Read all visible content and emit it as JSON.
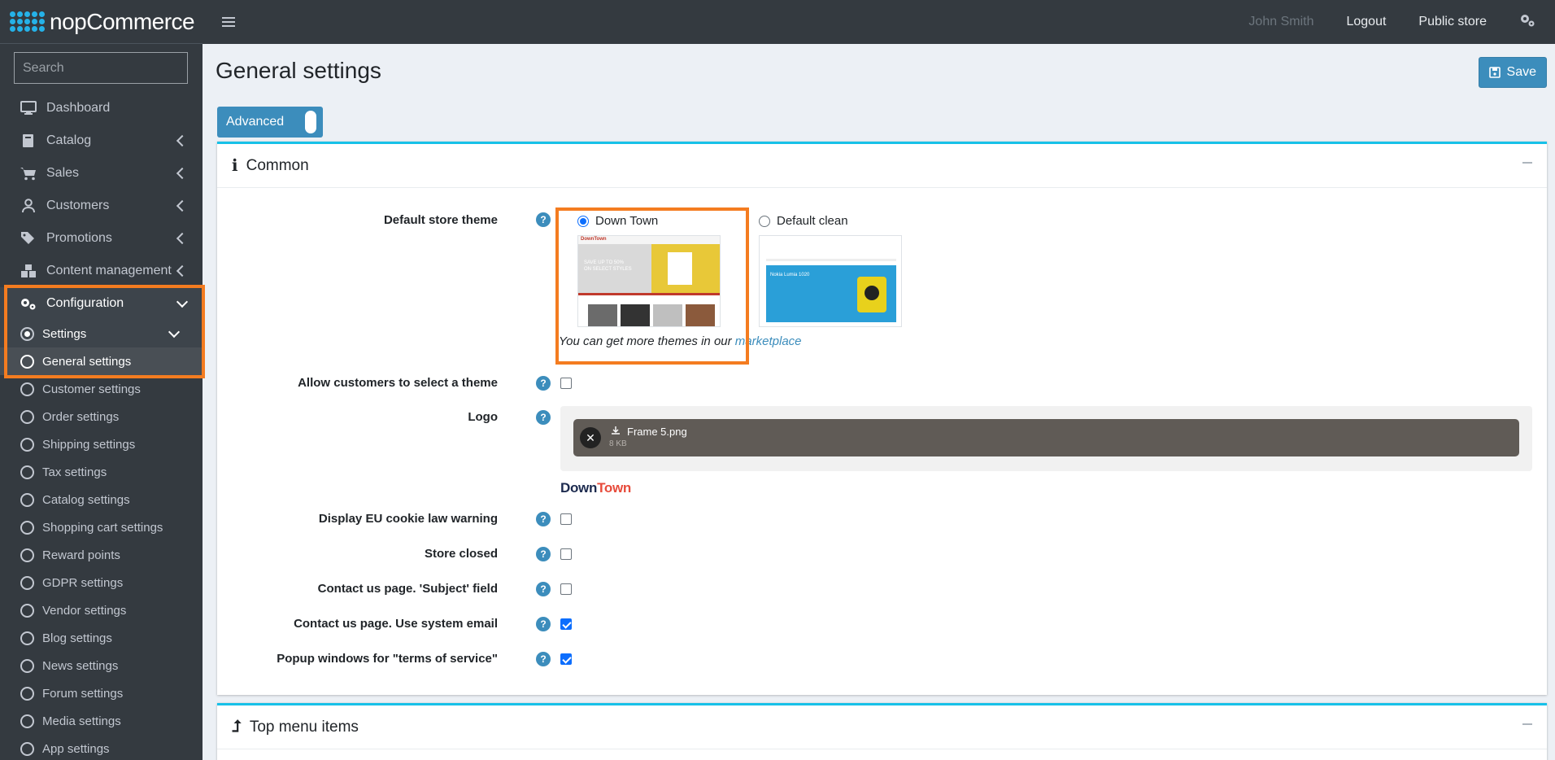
{
  "brand": {
    "name": "nopCommerce"
  },
  "search": {
    "placeholder": "Search"
  },
  "topbar": {
    "user": "John Smith",
    "logout": "Logout",
    "public_store": "Public store"
  },
  "sidebar": {
    "items": [
      {
        "label": "Dashboard"
      },
      {
        "label": "Catalog"
      },
      {
        "label": "Sales"
      },
      {
        "label": "Customers"
      },
      {
        "label": "Promotions"
      },
      {
        "label": "Content management"
      },
      {
        "label": "Configuration"
      }
    ],
    "sub_items": [
      "Settings",
      "General settings",
      "Customer settings",
      "Order settings",
      "Shipping settings",
      "Tax settings",
      "Catalog settings",
      "Shopping cart settings",
      "Reward points",
      "GDPR settings",
      "Vendor settings",
      "Blog settings",
      "News settings",
      "Forum settings",
      "Media settings",
      "App settings"
    ]
  },
  "page": {
    "title": "General settings",
    "save_label": "Save",
    "advanced_label": "Advanced"
  },
  "common": {
    "header": "Common",
    "default_theme_label": "Default store theme",
    "themes": [
      {
        "name": "Down Town",
        "selected": true
      },
      {
        "name": "Default clean",
        "selected": false
      }
    ],
    "themes_note_prefix": "You can get more themes in our ",
    "themes_note_link": "marketplace",
    "allow_theme_label": "Allow customers to select a theme",
    "logo_label": "Logo",
    "logo_file": {
      "name": "Frame 5.png",
      "size": "8 KB"
    },
    "logo_preview_a": "Down",
    "logo_preview_b": "Town",
    "fields": [
      {
        "label": "Display EU cookie law warning",
        "checked": false
      },
      {
        "label": "Store closed",
        "checked": false
      },
      {
        "label": "Contact us page. 'Subject' field",
        "checked": false
      },
      {
        "label": "Contact us page. Use system email",
        "checked": true
      },
      {
        "label": "Popup windows for \"terms of service\"",
        "checked": true
      }
    ]
  },
  "top_menu": {
    "header": "Top menu items"
  },
  "thumb_downtown": {
    "brand": "DownTown",
    "promo": "SAVE UP TO 50%",
    "promo2": "ON SELECT STYLES"
  },
  "thumb_clean": {
    "product": "Nokia Lumia 1020"
  },
  "help_glyph": "?",
  "colors": {
    "accent": "#3c8dbc",
    "sidebar": "#343a40",
    "highlight": "#f47c20",
    "card_border": "#17c1e8"
  }
}
